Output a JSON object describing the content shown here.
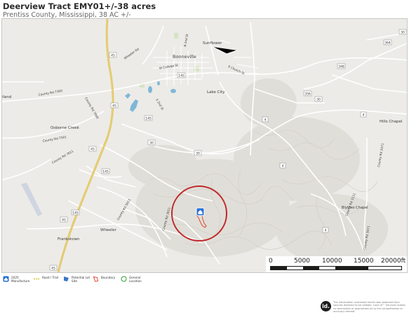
{
  "header": {
    "title": "Deerview Tract EMY01+/-38 acres",
    "subtitle": "Prentiss County, Mississippi, 38 AC +/-"
  },
  "map": {
    "place_labels": {
      "booneville": "Booneville",
      "sunflower": "Sunflower",
      "lake_city": "Lake City",
      "osborne_creek": "Osborne Creek",
      "hills_chapel": "Hills Chapel",
      "blythes_chapel": "Blythes Chapel",
      "wheeler": "Wheeler",
      "frankstown": "Frankstown",
      "iland": "iland"
    },
    "road_labels": {
      "n2nd": "N 2nd St",
      "wheeler_rd": "Wheeler Rd",
      "college": "W College St",
      "e_church": "E Church St",
      "s2nd": "S 2nd St",
      "cr7300": "County Rd 7300",
      "cr7000": "County Rd 7000",
      "cr7501": "County Rd 7501",
      "cr7611": "County Rd 7611",
      "cr5011": "County Rd 5011",
      "cr2071": "County Rd 2071",
      "cr3011": "County Rd 3011",
      "cr3111": "County Rd 3111",
      "cr3071": "County Rd 3071"
    },
    "shields": {
      "hwy45": "45",
      "hwy30": "30",
      "hwy4": "4",
      "hwy145": "145",
      "hwy364": "364",
      "hwy348": "348",
      "hwy356": "356"
    },
    "scale": {
      "labels": [
        "0",
        "5000",
        "10000",
        "15000",
        "20000ft"
      ]
    }
  },
  "legend": [
    {
      "icon": "home-marker-icon",
      "color": "#2b6fd6",
      "label": "2025\nManufacture"
    },
    {
      "icon": "road-trail-icon",
      "color": "#d8c33a",
      "label": "Road / Trail"
    },
    {
      "icon": "potential-lot-site-icon",
      "color": "#3b76c9",
      "label": "Potential Lot\nSite"
    },
    {
      "icon": "boundary-icon",
      "color": "#e0472f",
      "label": "Boundary"
    },
    {
      "icon": "general-location-icon",
      "color": "#4caf50",
      "label": "General\nLocation"
    }
  ],
  "footer": {
    "logo": "id.",
    "disclaimer": "The information contained herein was obtained from sources deemed to be reliable. Land id™ Services makes no warranties or guarantees as to the completeness or accuracy thereof."
  },
  "colors": {
    "map_background": "#ecebe7",
    "major_road": "#d9b84a",
    "minor_road": "#ffffff",
    "location_circle": "#c0282a",
    "boundary": "#e0472f",
    "water": "#7fb7d8"
  }
}
